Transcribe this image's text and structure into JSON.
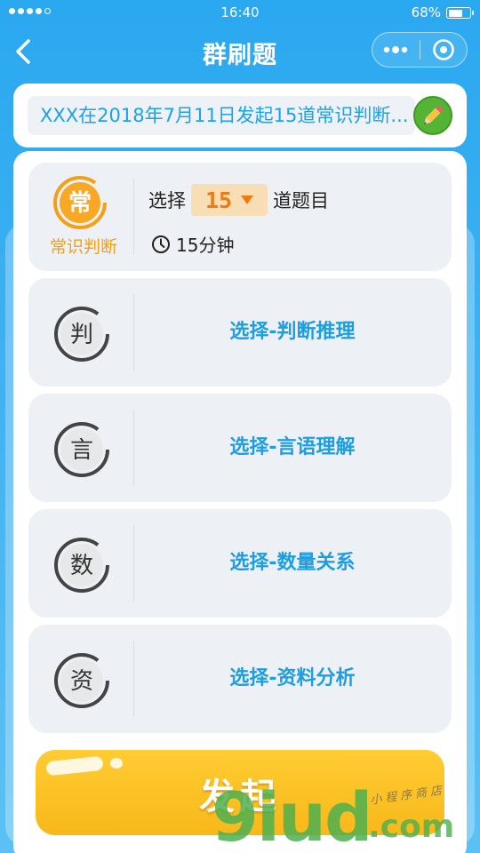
{
  "status_bar": {
    "time": "16:40",
    "battery_percent": "68%",
    "battery_level": 0.68
  },
  "nav": {
    "title": "群刷题"
  },
  "title_input": {
    "value": "XXX在2018年7月11日发起15道常识判断..."
  },
  "active_category": {
    "icon_char": "常",
    "name": "常识判断",
    "select_prefix": "选择",
    "question_count": "15",
    "select_suffix": "道题目",
    "duration": "15分钟",
    "color": "#f3a018"
  },
  "categories": [
    {
      "icon_char": "判",
      "label": "选择-判断推理"
    },
    {
      "icon_char": "言",
      "label": "选择-言语理解"
    },
    {
      "icon_char": "数",
      "label": "选择-数量关系"
    },
    {
      "icon_char": "资",
      "label": "选择-资料分析"
    }
  ],
  "launch_button": {
    "label": "发起",
    "color": "#f7b81a"
  },
  "watermark": {
    "text": "9iud",
    "suffix": ".com",
    "tagline": "小程序商店"
  },
  "colors": {
    "accent_blue": "#1c9ee0",
    "background": "#2aa8f0"
  }
}
